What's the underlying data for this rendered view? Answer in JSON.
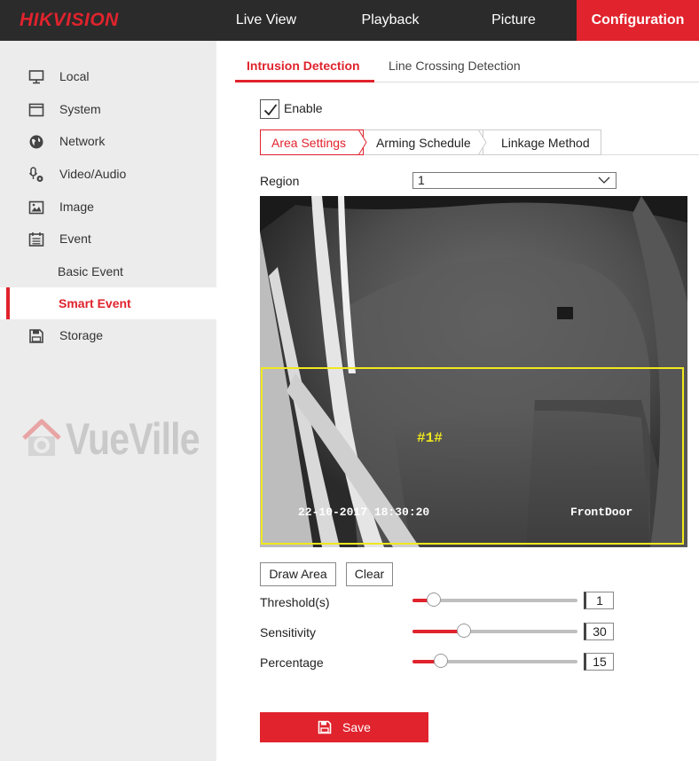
{
  "brand": {
    "logo": "HIKVISION",
    "accent": "#e0232d"
  },
  "topnav": {
    "items": [
      {
        "label": "Live View"
      },
      {
        "label": "Playback"
      },
      {
        "label": "Picture"
      },
      {
        "label": "Configuration",
        "active": true
      }
    ]
  },
  "sidebar": {
    "items": [
      {
        "label": "Local",
        "icon": "monitor-icon"
      },
      {
        "label": "System",
        "icon": "system-window-icon"
      },
      {
        "label": "Network",
        "icon": "globe-icon"
      },
      {
        "label": "Video/Audio",
        "icon": "microphone-camera-icon"
      },
      {
        "label": "Image",
        "icon": "image-icon"
      },
      {
        "label": "Event",
        "icon": "calendar-icon"
      },
      {
        "label": "Basic Event"
      },
      {
        "label": "Smart Event",
        "active": true
      },
      {
        "label": "Storage",
        "icon": "floppy-disk-icon"
      }
    ],
    "watermark": "VueVille"
  },
  "tabs": {
    "items": [
      {
        "label": "Intrusion Detection",
        "active": true
      },
      {
        "label": "Line Crossing Detection"
      }
    ]
  },
  "enable": {
    "label": "Enable",
    "checked": true
  },
  "steps": {
    "items": [
      {
        "label": "Area Settings",
        "active": true
      },
      {
        "label": "Arming Schedule"
      },
      {
        "label": "Linkage Method"
      }
    ]
  },
  "region": {
    "label": "Region",
    "value": "1"
  },
  "video": {
    "roi_label": "#1#",
    "osd_time": "22-10-2017 18:30:20",
    "osd_name": "FrontDoor",
    "roi_color": "#f0e81e"
  },
  "buttons": {
    "draw_area": "Draw Area",
    "clear": "Clear",
    "save": "Save"
  },
  "sliders": [
    {
      "label": "Threshold(s)",
      "value": "1",
      "fraction": 0.13
    },
    {
      "label": "Sensitivity",
      "value": "30",
      "fraction": 0.31
    },
    {
      "label": "Percentage",
      "value": "15",
      "fraction": 0.17
    }
  ]
}
